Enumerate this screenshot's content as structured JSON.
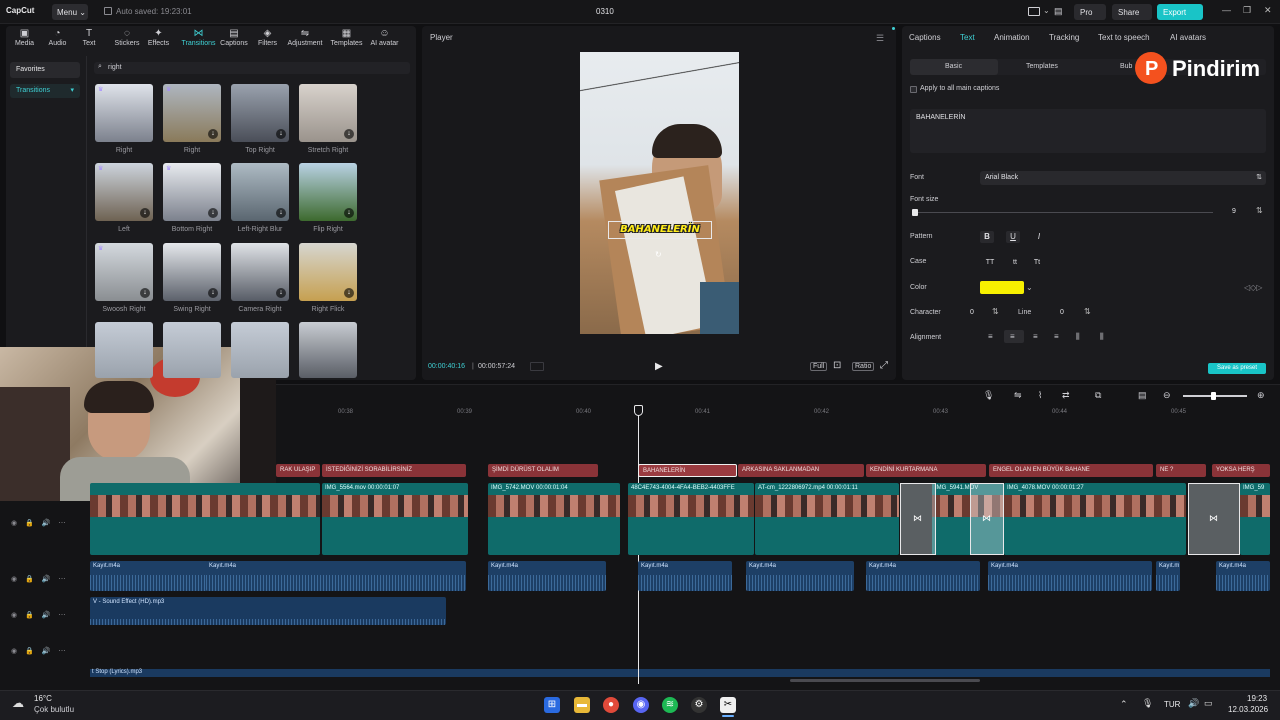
{
  "app": {
    "logo": "CapCut",
    "menu_label": "Menu",
    "autosave": "Auto saved: 19:23:01",
    "project_title": "0310",
    "pro_label": "Pro",
    "share_label": "Share",
    "export_label": "Export"
  },
  "toolbar": {
    "items": [
      "Media",
      "Audio",
      "Text",
      "Stickers",
      "Effects",
      "Transitions",
      "Captions",
      "Filters",
      "Adjustment",
      "Templates",
      "AI avatar"
    ],
    "active": "Transitions"
  },
  "left": {
    "favorites": "Favorites",
    "transitions": "Transitions",
    "search_value": "right"
  },
  "transitions": [
    {
      "label": "Right"
    },
    {
      "label": "Right"
    },
    {
      "label": "Top Right"
    },
    {
      "label": "Stretch Right"
    },
    {
      "label": "Left"
    },
    {
      "label": "Bottom Right"
    },
    {
      "label": "Left-Right Blur"
    },
    {
      "label": "Flip Right"
    },
    {
      "label": "Swoosh Right"
    },
    {
      "label": "Swing Right"
    },
    {
      "label": "Camera Right"
    },
    {
      "label": "Right Flick"
    }
  ],
  "player": {
    "title": "Player",
    "caption": "BAHANELERİN",
    "time_current": "00:00:40:16",
    "time_total": "00:00:57:24",
    "full_label": "Full",
    "ratio_label": "Ratio"
  },
  "right": {
    "tabs": [
      "Captions",
      "Text",
      "Animation",
      "Tracking",
      "Text to speech",
      "AI avatars"
    ],
    "active_tab": "Text",
    "subtabs": [
      "Basic",
      "Templates",
      "Bub"
    ],
    "apply_all": "Apply to all main captions",
    "caption_text": "BAHANELERİN",
    "font_label": "Font",
    "font_value": "Arial Black",
    "font_size_label": "Font size",
    "font_size_value": "9",
    "font_size_fraction": 0.01,
    "pattern_label": "Pattern",
    "case_label": "Case",
    "case_options": [
      "TT",
      "tt",
      "Tt"
    ],
    "color_label": "Color",
    "color_value": "#f7f000",
    "character_label": "Character",
    "character_value": "0",
    "line_label": "Line",
    "line_value": "0",
    "alignment_label": "Alignment",
    "save_preset": "Save as preset",
    "brand": "Pindirim"
  },
  "timeline": {
    "ruler": [
      "00:38",
      "00:39",
      "00:40",
      "00:41",
      "00:42",
      "00:43",
      "00:44",
      "00:45"
    ],
    "captions": [
      "RAK ULAŞIP",
      "İSTEDİĞİNİZİ SORABİLİRSİNİZ",
      "ŞİMDİ DÜRÜST OLALIM",
      "BAHANELERİN",
      "ARKASINA SAKLANMADAN",
      "KENDİNİ KURTARMANA",
      "ENGEL OLAN EN BÜYÜK BAHANE",
      "NE ?",
      "YOKSA HERŞ"
    ],
    "video_clips": [
      "IMG_5564.mov  00:00:01:07",
      "IMG_5742.MOV  00:00:01:04",
      "48C4E743-4004-4FA4-BEB2-4403FFE",
      "AT-cm_1222806972.mp4  00:00:01:11",
      "IMG_5941.MOV",
      "IMG_4078.MOV  00:00:01:27",
      "IMG_59"
    ],
    "audio_label": "Kayıt.m4a",
    "audio_last": "Kayıt.m",
    "sfx_label": "V - Sound Effect (HD).mp3",
    "bottom_label": "t Stop (Lyrics).mp3"
  },
  "taskbar": {
    "temp": "16°C",
    "weather": "Çok bulutlu",
    "lang": "TUR",
    "time": "19:23",
    "date": "12.03.2026"
  }
}
